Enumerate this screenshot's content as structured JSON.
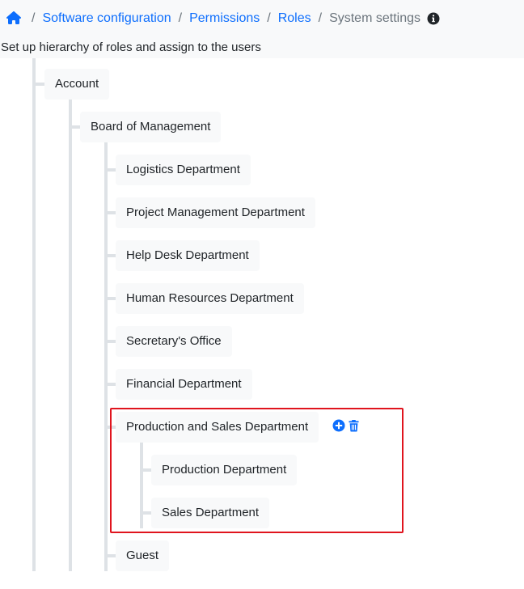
{
  "breadcrumb": {
    "home_icon": "home-icon",
    "items": [
      "Software configuration",
      "Permissions",
      "Roles"
    ],
    "current": "System settings",
    "separator": "/",
    "info_icon": "info-circle-icon"
  },
  "description": "Set up hierarchy of roles and assign to the users",
  "tree": {
    "root": "Account",
    "level1": "Board of Management",
    "departments": [
      "Logistics Department",
      "Project Management Department",
      "Help Desk Department",
      "Human Resources Department",
      "Secretary's Office",
      "Financial Department",
      "Production and Sales Department",
      "Guest"
    ],
    "production_children": [
      "Production Department",
      "Sales Department"
    ]
  },
  "actions": {
    "add_icon": "plus-circle-icon",
    "delete_icon": "trash-icon"
  },
  "colors": {
    "link": "#0d6efd",
    "node_bg": "#f8f9fa",
    "tree_line": "#dee2e6",
    "highlight": "#e0141e"
  }
}
